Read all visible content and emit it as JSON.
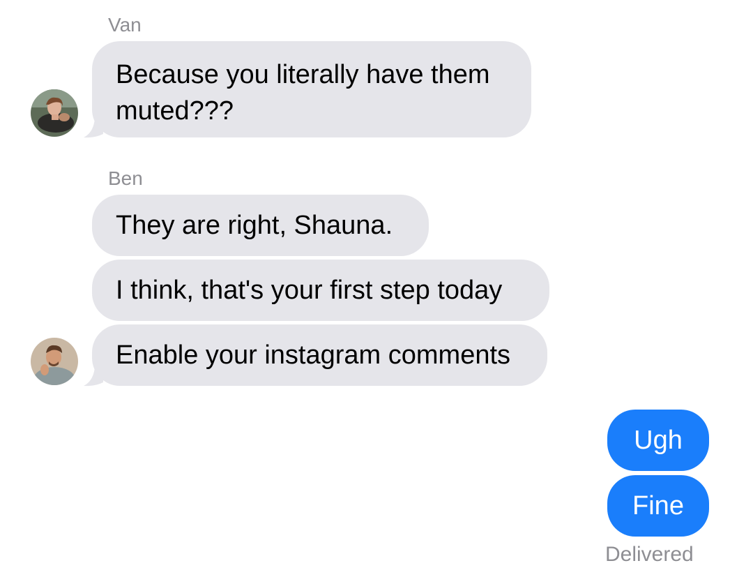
{
  "thread": {
    "groups": [
      {
        "sender": "Van",
        "avatar_icon": "van-avatar-photo",
        "messages": [
          "Because you literally have them muted???"
        ]
      },
      {
        "sender": "Ben",
        "avatar_icon": "ben-avatar-photo",
        "messages": [
          "They are right, Shauna.",
          "I think, that's your first step today",
          "Enable your instagram comments"
        ]
      }
    ],
    "outgoing": {
      "messages": [
        "Ugh",
        "Fine"
      ],
      "status": "Delivered"
    }
  },
  "colors": {
    "incoming_bubble": "#e5e5ea",
    "outgoing_bubble": "#1a7efb",
    "meta_text": "#8e8e93"
  }
}
